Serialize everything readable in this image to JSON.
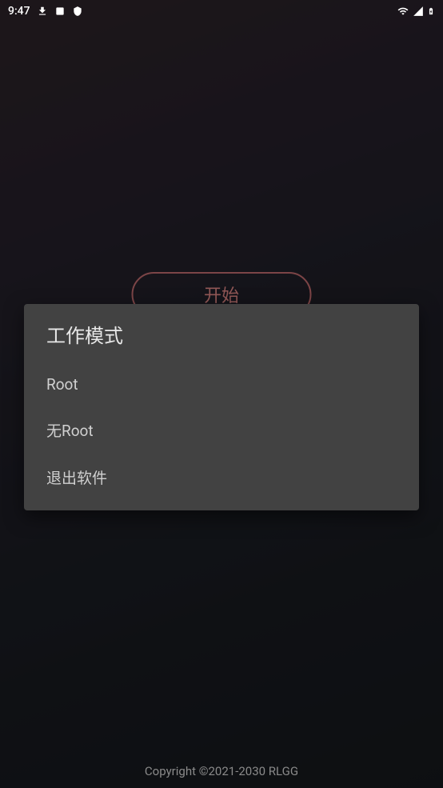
{
  "status_bar": {
    "time": "9:47"
  },
  "main": {
    "start_button_label": "开始"
  },
  "dialog": {
    "title": "工作模式",
    "options": [
      "Root",
      "无Root",
      "退出软件"
    ]
  },
  "footer": {
    "copyright": "Copyright ©2021-2030 RLGG"
  }
}
